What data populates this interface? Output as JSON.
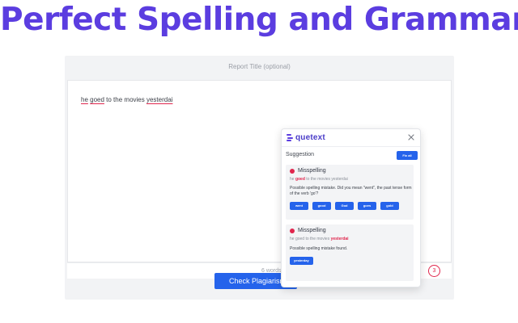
{
  "headline": "Perfect Spelling and Grammar",
  "report": {
    "title_placeholder": "Report Title (optional)"
  },
  "editor": {
    "words": [
      {
        "text": "he",
        "error": true
      },
      {
        "text": " ",
        "error": false
      },
      {
        "text": "goed",
        "error": true
      },
      {
        "text": " to the movies ",
        "error": false
      },
      {
        "text": "yesterdai",
        "error": true
      }
    ],
    "word_count": "6 words",
    "issue_count": "3"
  },
  "check_button": "Check Plagiarism",
  "popup": {
    "logo": "quetext",
    "suggestion_label": "Suggestion",
    "fix_all": "Fix all",
    "cards": [
      {
        "type": "Misspelling",
        "context_before": "he ",
        "context_error": "goed",
        "context_after": " to the movies yesterdai",
        "message": "Possible spelling mistake. Did you mean \"went\", the past tense form of the verb 'go'?",
        "options": [
          "went",
          "good",
          "God",
          "goes",
          "gold"
        ]
      },
      {
        "type": "Misspelling",
        "context_before": "he goed to the movies ",
        "context_error": "yesterdai",
        "context_after": "",
        "message": "Possible spelling mistake found.",
        "options": [
          "yesterday"
        ]
      }
    ]
  },
  "colors": {
    "headline": "#5b3de0",
    "primary": "#2563eb",
    "error": "#e0264d"
  }
}
